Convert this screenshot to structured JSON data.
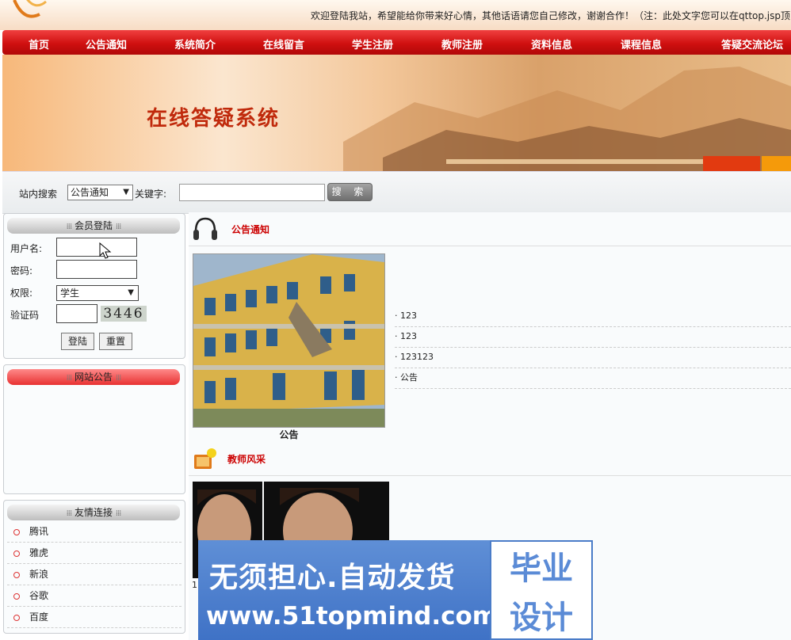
{
  "header": {
    "welcome_text": "欢迎登陆我站，希望能给你带来好心情，其他话语请您自己修改，谢谢合作！（注：此处文字您可以在qttop.jsp顶"
  },
  "nav": {
    "items": [
      {
        "label": "首页"
      },
      {
        "label": "公告通知"
      },
      {
        "label": "系统简介"
      },
      {
        "label": "在线留言"
      },
      {
        "label": "学生注册"
      },
      {
        "label": "教师注册"
      },
      {
        "label": "资料信息"
      },
      {
        "label": "课程信息"
      },
      {
        "label": "答疑交流论坛"
      }
    ]
  },
  "banner": {
    "title": "在线答疑系统"
  },
  "search": {
    "label": "站内搜索",
    "category": "公告通知",
    "keyword_label": "关键字:",
    "keyword_value": "",
    "button": "搜 索"
  },
  "login": {
    "title": "会员登陆",
    "username_label": "用户名:",
    "username_value": "",
    "password_label": "密码:",
    "password_value": "",
    "role_label": "权限:",
    "role_value": "学生",
    "captcha_label": "验证码",
    "captcha_value": "",
    "captcha_image_text": "3446",
    "login_button": "登陆",
    "reset_button": "重置"
  },
  "announcements_panel": {
    "title": "网站公告"
  },
  "links_panel": {
    "title": "友情连接",
    "items": [
      {
        "label": "腾讯"
      },
      {
        "label": "雅虎"
      },
      {
        "label": "新浪"
      },
      {
        "label": "谷歌"
      },
      {
        "label": "百度"
      }
    ]
  },
  "notices": {
    "title": "公告通知",
    "photo_caption": "公告",
    "items": [
      {
        "label": "· 123"
      },
      {
        "label": "· 123"
      },
      {
        "label": "· 123123"
      },
      {
        "label": "· 公告"
      }
    ]
  },
  "teachers": {
    "title": "教师风采",
    "items": [
      {
        "caption": "1"
      },
      {
        "caption": "1"
      }
    ]
  },
  "watermark": {
    "line1": "无须担心.自动发货",
    "line2": "www.51topmind.com",
    "box_line1": "毕业",
    "box_line2": "设计"
  },
  "colors": {
    "nav_red": "#d01010",
    "title_red": "#c00000",
    "banner_title": "#c02a0c",
    "watermark_blue": "#4a7cc8"
  }
}
